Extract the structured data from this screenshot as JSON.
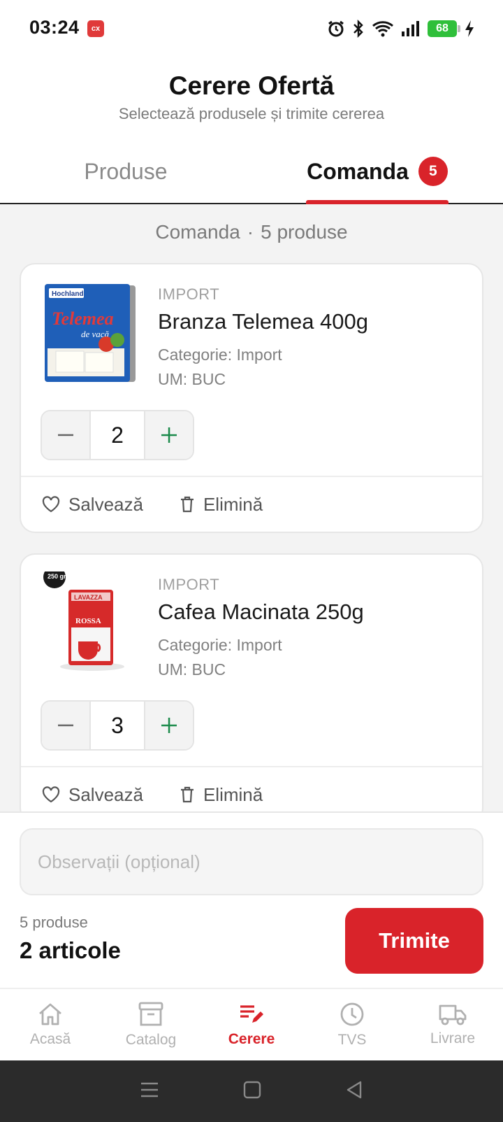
{
  "status_bar": {
    "time": "03:24",
    "app_badge": "cx",
    "battery": "68"
  },
  "header": {
    "title": "Cerere Ofertă",
    "subtitle": "Selectează produsele și trimite cererea"
  },
  "tabs": [
    {
      "label": "Produse"
    },
    {
      "label": "Comanda",
      "badge": "5"
    }
  ],
  "section": {
    "label": "Comanda",
    "separator": "·",
    "count": "5 produse"
  },
  "items": [
    {
      "tag": "IMPORT",
      "name": "Branza Telemea 400g",
      "category": "Categorie: Import",
      "unit": "UM: BUC",
      "quantity": "2",
      "save_label": "Salvează",
      "remove_label": "Elimină",
      "image_brand": "Hochland",
      "image_text": "Telemea",
      "image_sub": "de vacă"
    },
    {
      "tag": "IMPORT",
      "name": "Cafea Macinata 250g",
      "category": "Categorie: Import",
      "unit": "UM: BUC",
      "quantity": "3",
      "save_label": "Salvează",
      "remove_label": "Elimină",
      "image_brand": "LAVAZZA",
      "image_text": "ROSSA",
      "image_sub": "250 gr."
    }
  ],
  "footer": {
    "notes_placeholder": "Observații (opțional)",
    "summary_count": "5 produse",
    "summary_articles": "2 articole",
    "send_label": "Trimite"
  },
  "bottom_nav": [
    {
      "label": "Acasă",
      "icon": "home-icon"
    },
    {
      "label": "Catalog",
      "icon": "archive-icon"
    },
    {
      "label": "Cerere",
      "icon": "edit-list-icon",
      "active": true
    },
    {
      "label": "TVS",
      "icon": "clock-icon"
    },
    {
      "label": "Livrare",
      "icon": "truck-icon"
    }
  ],
  "colors": {
    "accent": "#d9232a",
    "plus": "#1a8a4a",
    "battery": "#2fbf3a"
  }
}
